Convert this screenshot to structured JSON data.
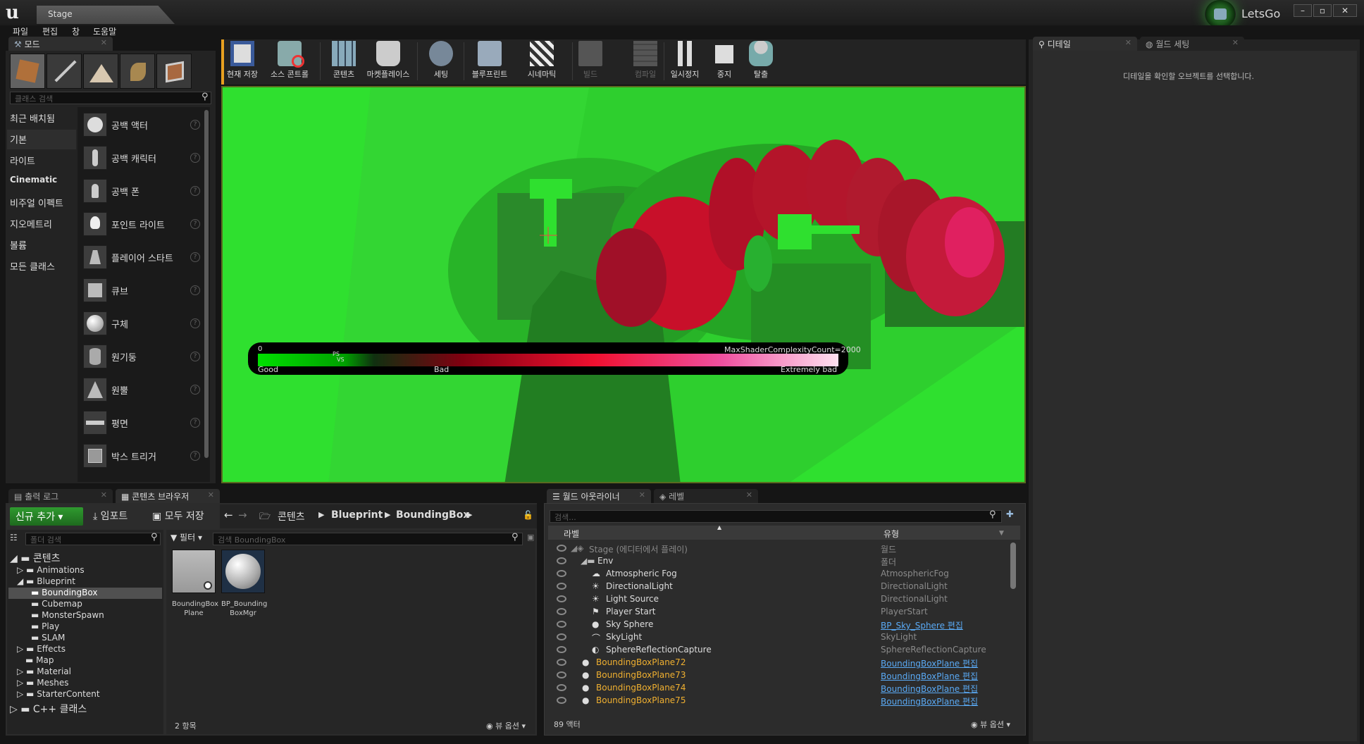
{
  "window": {
    "tab_title": "Stage",
    "user": "LetsGo"
  },
  "menu": [
    "파일",
    "편집",
    "창",
    "도움말"
  ],
  "modes_panel": {
    "tab": "모드",
    "search_placeholder": "클래스 검색",
    "categories": [
      "최근 배치됨",
      "기본",
      "라이트",
      "Cinematic",
      "비주얼 이펙트",
      "지오메트리",
      "볼륨",
      "모든 클래스"
    ],
    "active_category": "기본",
    "items": [
      "공백 액터",
      "공백 캐릭터",
      "공백 폰",
      "포인트 라이트",
      "플레이어 스타트",
      "큐브",
      "구체",
      "원기둥",
      "원뿔",
      "평면",
      "박스 트리거"
    ]
  },
  "toolbar": {
    "buttons": [
      "현재 저장",
      "소스 콘트롤",
      "콘텐츠",
      "마켓플레이스",
      "세팅",
      "블루프린트",
      "시네마틱",
      "빌드",
      "컴파일",
      "일시정지",
      "중지",
      "탈출"
    ]
  },
  "viewport": {
    "legend_min": "0",
    "legend_max": "MaxShaderComplexityCount=2000",
    "legend_good": "Good",
    "legend_bad": "Bad",
    "legend_extreme": "Extremely bad",
    "marker_ps": "PS",
    "marker_vs": "VS"
  },
  "details_panel": {
    "tab_details": "디테일",
    "tab_world": "월드 세팅",
    "message": "디테일을 확인할 오브젝트를 선택합니다."
  },
  "bottom_tabs": {
    "output_log": "출력 로그",
    "content_browser": "콘텐츠 브라우저"
  },
  "content_browser": {
    "add_new": "신규 추가",
    "import": "임포트",
    "save_all": "모두 저장",
    "path": [
      "콘텐츠",
      "Blueprint",
      "BoundingBox"
    ],
    "folder_search": "폴더 검색",
    "filter": "필터",
    "asset_search": "검색 BoundingBox",
    "tree": [
      {
        "label": "콘텐츠",
        "depth": 0
      },
      {
        "label": "Animations",
        "depth": 1
      },
      {
        "label": "Blueprint",
        "depth": 1
      },
      {
        "label": "BoundingBox",
        "depth": 2,
        "selected": true
      },
      {
        "label": "Cubemap",
        "depth": 2
      },
      {
        "label": "MonsterSpawn",
        "depth": 2
      },
      {
        "label": "Play",
        "depth": 2
      },
      {
        "label": "SLAM",
        "depth": 2
      },
      {
        "label": "Effects",
        "depth": 1
      },
      {
        "label": "Map",
        "depth": 1
      },
      {
        "label": "Material",
        "depth": 1
      },
      {
        "label": "Meshes",
        "depth": 1
      },
      {
        "label": "StarterContent",
        "depth": 1
      },
      {
        "label": "C++ 클래스",
        "depth": 0
      }
    ],
    "assets": [
      {
        "line1": "BoundingBox",
        "line2": "Plane"
      },
      {
        "line1": "BP_Bounding",
        "line2": "BoxMgr"
      }
    ],
    "item_count": "2 항목",
    "view_options": "뷰 옵션"
  },
  "outliner": {
    "tab": "월드 아웃라이너",
    "tab_levels": "레벨",
    "search_placeholder": "검색...",
    "col_label": "라벨",
    "col_type": "유형",
    "rows": [
      {
        "name": "Stage (에디터에서 플레이)",
        "type": "월드",
        "indent": 0,
        "dim": true
      },
      {
        "name": "Env",
        "type": "폴더",
        "indent": 1
      },
      {
        "name": "Atmospheric Fog",
        "type": "AtmosphericFog",
        "indent": 2
      },
      {
        "name": "DirectionalLight",
        "type": "DirectionalLight",
        "indent": 2
      },
      {
        "name": "Light Source",
        "type": "DirectionalLight",
        "indent": 2
      },
      {
        "name": "Player Start",
        "type": "PlayerStart",
        "indent": 2
      },
      {
        "name": "Sky Sphere",
        "type": "BP_Sky_Sphere 편집",
        "indent": 2,
        "link": true
      },
      {
        "name": "SkyLight",
        "type": "SkyLight",
        "indent": 2
      },
      {
        "name": "SphereReflectionCapture",
        "type": "SphereReflectionCapture",
        "indent": 2
      },
      {
        "name": "BoundingBoxPlane72",
        "type": "BoundingBoxPlane 편집",
        "indent": 1,
        "link": true,
        "orange": true
      },
      {
        "name": "BoundingBoxPlane73",
        "type": "BoundingBoxPlane 편집",
        "indent": 1,
        "link": true,
        "orange": true
      },
      {
        "name": "BoundingBoxPlane74",
        "type": "BoundingBoxPlane 편집",
        "indent": 1,
        "link": true,
        "orange": true
      },
      {
        "name": "BoundingBoxPlane75",
        "type": "BoundingBoxPlane 편집",
        "indent": 1,
        "link": true,
        "orange": true
      }
    ],
    "actor_count": "89 액터",
    "view_options": "뷰 옵션"
  },
  "colors": {
    "accent_green": "#2fe02f",
    "link_blue": "#5aaaf5",
    "orange_text": "#f0b030"
  }
}
